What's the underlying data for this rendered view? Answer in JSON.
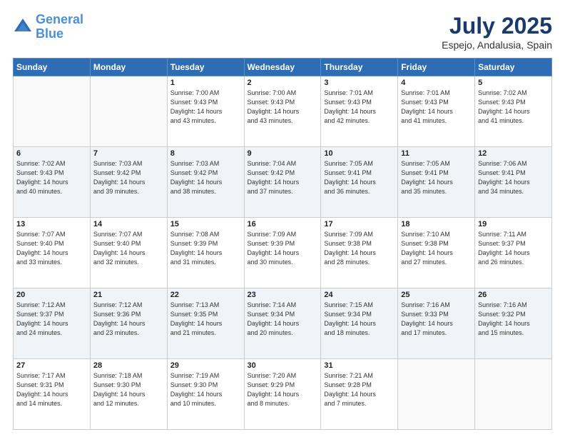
{
  "header": {
    "logo_line1": "General",
    "logo_line2": "Blue",
    "month_year": "July 2025",
    "location": "Espejo, Andalusia, Spain"
  },
  "days_of_week": [
    "Sunday",
    "Monday",
    "Tuesday",
    "Wednesday",
    "Thursday",
    "Friday",
    "Saturday"
  ],
  "weeks": [
    [
      {
        "day": "",
        "info": ""
      },
      {
        "day": "",
        "info": ""
      },
      {
        "day": "1",
        "info": "Sunrise: 7:00 AM\nSunset: 9:43 PM\nDaylight: 14 hours\nand 43 minutes."
      },
      {
        "day": "2",
        "info": "Sunrise: 7:00 AM\nSunset: 9:43 PM\nDaylight: 14 hours\nand 43 minutes."
      },
      {
        "day": "3",
        "info": "Sunrise: 7:01 AM\nSunset: 9:43 PM\nDaylight: 14 hours\nand 42 minutes."
      },
      {
        "day": "4",
        "info": "Sunrise: 7:01 AM\nSunset: 9:43 PM\nDaylight: 14 hours\nand 41 minutes."
      },
      {
        "day": "5",
        "info": "Sunrise: 7:02 AM\nSunset: 9:43 PM\nDaylight: 14 hours\nand 41 minutes."
      }
    ],
    [
      {
        "day": "6",
        "info": "Sunrise: 7:02 AM\nSunset: 9:43 PM\nDaylight: 14 hours\nand 40 minutes."
      },
      {
        "day": "7",
        "info": "Sunrise: 7:03 AM\nSunset: 9:42 PM\nDaylight: 14 hours\nand 39 minutes."
      },
      {
        "day": "8",
        "info": "Sunrise: 7:03 AM\nSunset: 9:42 PM\nDaylight: 14 hours\nand 38 minutes."
      },
      {
        "day": "9",
        "info": "Sunrise: 7:04 AM\nSunset: 9:42 PM\nDaylight: 14 hours\nand 37 minutes."
      },
      {
        "day": "10",
        "info": "Sunrise: 7:05 AM\nSunset: 9:41 PM\nDaylight: 14 hours\nand 36 minutes."
      },
      {
        "day": "11",
        "info": "Sunrise: 7:05 AM\nSunset: 9:41 PM\nDaylight: 14 hours\nand 35 minutes."
      },
      {
        "day": "12",
        "info": "Sunrise: 7:06 AM\nSunset: 9:41 PM\nDaylight: 14 hours\nand 34 minutes."
      }
    ],
    [
      {
        "day": "13",
        "info": "Sunrise: 7:07 AM\nSunset: 9:40 PM\nDaylight: 14 hours\nand 33 minutes."
      },
      {
        "day": "14",
        "info": "Sunrise: 7:07 AM\nSunset: 9:40 PM\nDaylight: 14 hours\nand 32 minutes."
      },
      {
        "day": "15",
        "info": "Sunrise: 7:08 AM\nSunset: 9:39 PM\nDaylight: 14 hours\nand 31 minutes."
      },
      {
        "day": "16",
        "info": "Sunrise: 7:09 AM\nSunset: 9:39 PM\nDaylight: 14 hours\nand 30 minutes."
      },
      {
        "day": "17",
        "info": "Sunrise: 7:09 AM\nSunset: 9:38 PM\nDaylight: 14 hours\nand 28 minutes."
      },
      {
        "day": "18",
        "info": "Sunrise: 7:10 AM\nSunset: 9:38 PM\nDaylight: 14 hours\nand 27 minutes."
      },
      {
        "day": "19",
        "info": "Sunrise: 7:11 AM\nSunset: 9:37 PM\nDaylight: 14 hours\nand 26 minutes."
      }
    ],
    [
      {
        "day": "20",
        "info": "Sunrise: 7:12 AM\nSunset: 9:37 PM\nDaylight: 14 hours\nand 24 minutes."
      },
      {
        "day": "21",
        "info": "Sunrise: 7:12 AM\nSunset: 9:36 PM\nDaylight: 14 hours\nand 23 minutes."
      },
      {
        "day": "22",
        "info": "Sunrise: 7:13 AM\nSunset: 9:35 PM\nDaylight: 14 hours\nand 21 minutes."
      },
      {
        "day": "23",
        "info": "Sunrise: 7:14 AM\nSunset: 9:34 PM\nDaylight: 14 hours\nand 20 minutes."
      },
      {
        "day": "24",
        "info": "Sunrise: 7:15 AM\nSunset: 9:34 PM\nDaylight: 14 hours\nand 18 minutes."
      },
      {
        "day": "25",
        "info": "Sunrise: 7:16 AM\nSunset: 9:33 PM\nDaylight: 14 hours\nand 17 minutes."
      },
      {
        "day": "26",
        "info": "Sunrise: 7:16 AM\nSunset: 9:32 PM\nDaylight: 14 hours\nand 15 minutes."
      }
    ],
    [
      {
        "day": "27",
        "info": "Sunrise: 7:17 AM\nSunset: 9:31 PM\nDaylight: 14 hours\nand 14 minutes."
      },
      {
        "day": "28",
        "info": "Sunrise: 7:18 AM\nSunset: 9:30 PM\nDaylight: 14 hours\nand 12 minutes."
      },
      {
        "day": "29",
        "info": "Sunrise: 7:19 AM\nSunset: 9:30 PM\nDaylight: 14 hours\nand 10 minutes."
      },
      {
        "day": "30",
        "info": "Sunrise: 7:20 AM\nSunset: 9:29 PM\nDaylight: 14 hours\nand 8 minutes."
      },
      {
        "day": "31",
        "info": "Sunrise: 7:21 AM\nSunset: 9:28 PM\nDaylight: 14 hours\nand 7 minutes."
      },
      {
        "day": "",
        "info": ""
      },
      {
        "day": "",
        "info": ""
      }
    ]
  ]
}
